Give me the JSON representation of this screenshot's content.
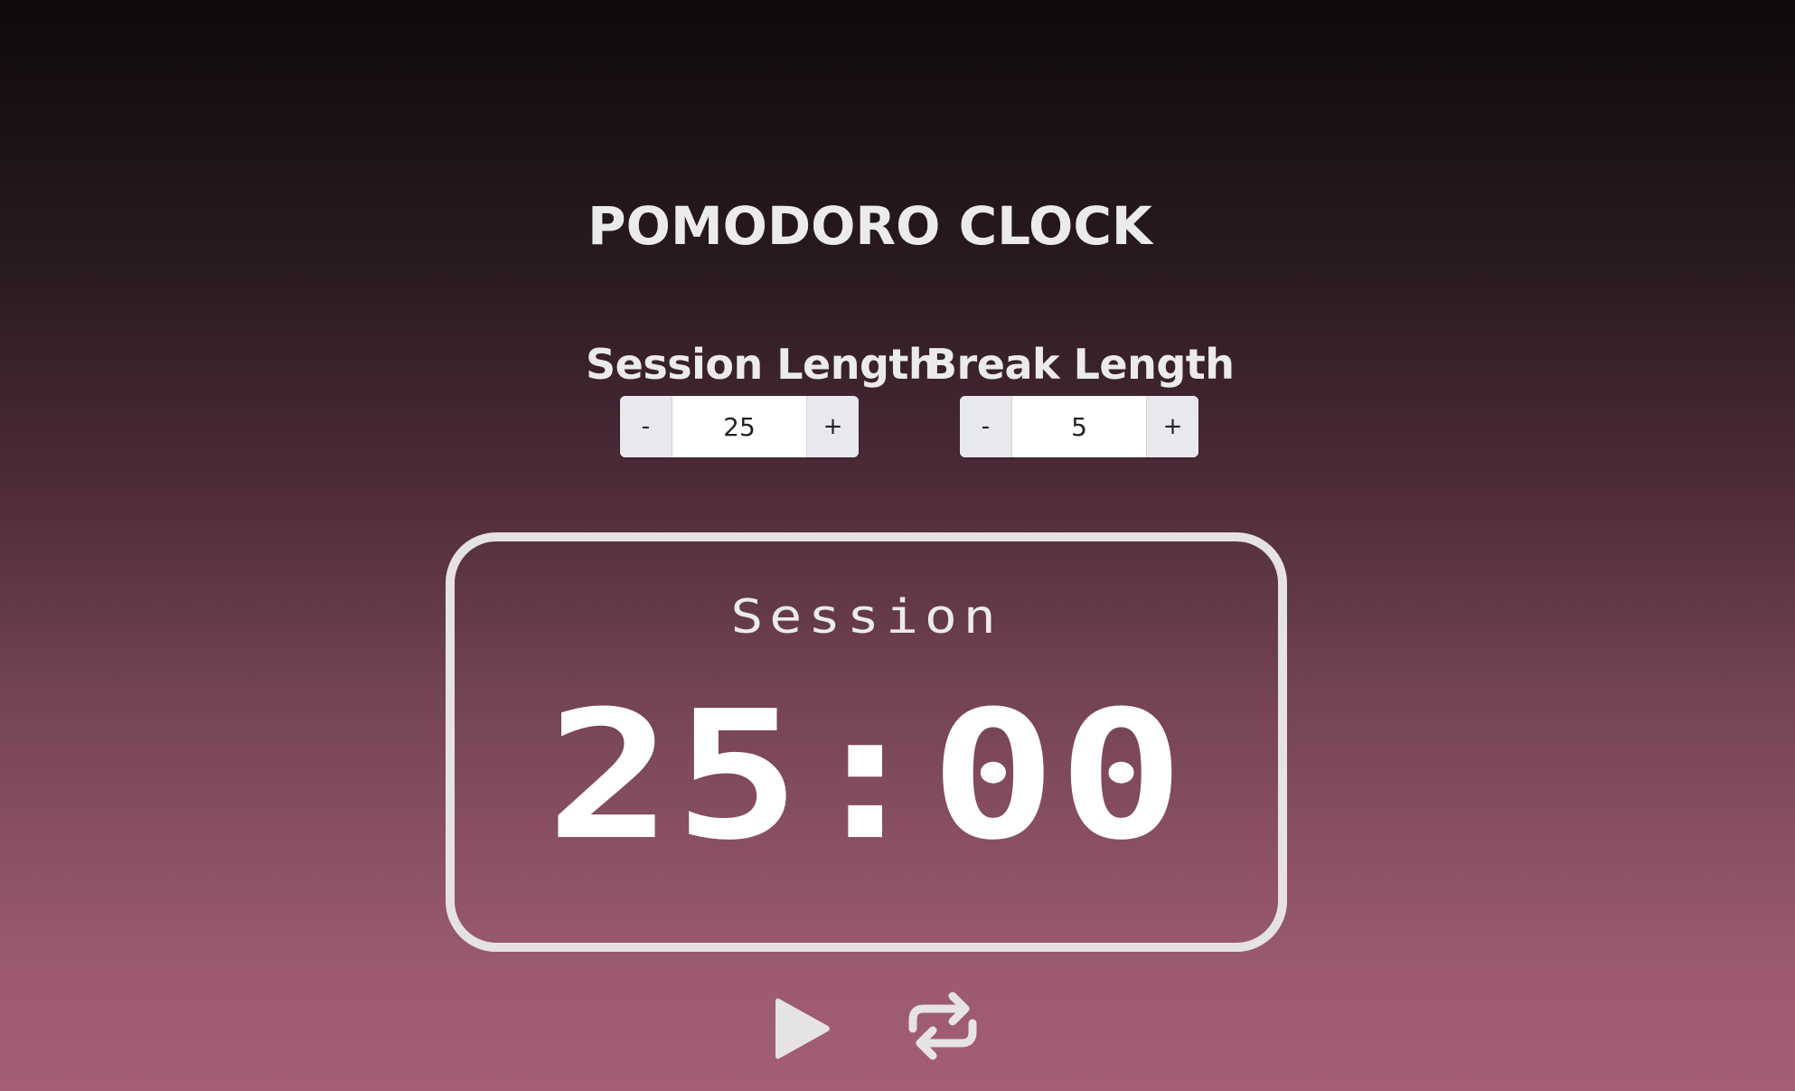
{
  "app": {
    "title": "POMODORO CLOCK"
  },
  "session_setting": {
    "label": "Session Length",
    "decrement_label": "-",
    "value": "25",
    "increment_label": "+"
  },
  "break_setting": {
    "label": "Break Length",
    "decrement_label": "-",
    "value": "5",
    "increment_label": "+"
  },
  "timer": {
    "mode_label": "Session",
    "time_display": "25:00"
  },
  "controls": {
    "play_icon": "play-icon",
    "reset_icon": "repeat-icon"
  },
  "colors": {
    "gradient_top": "#0e0a0c",
    "gradient_bottom": "#a45e75",
    "foreground": "#ecebeb",
    "button_bg": "#e7e9ec"
  }
}
